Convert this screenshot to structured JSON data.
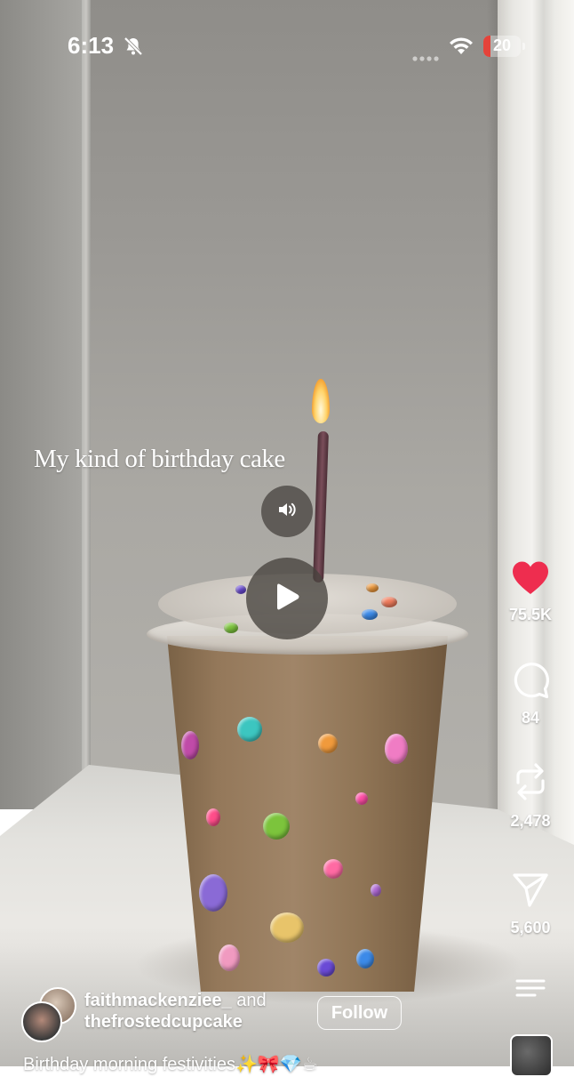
{
  "status_bar": {
    "time": "6:13",
    "battery": "20",
    "battery_level": 0.2,
    "icons": [
      "bell-off-icon",
      "more-dots-icon",
      "wifi-icon",
      "battery-icon"
    ]
  },
  "post": {
    "overlay_text": "My kind of birthday cake",
    "authors": {
      "primary": "faithmackenziee_",
      "joiner": "and",
      "secondary": "thefrostedcupcake"
    },
    "follow_label": "Follow",
    "caption": "Birthday morning festivities✨🎀💎☕"
  },
  "actions": {
    "likes": "75.5K",
    "comments": "84",
    "reposts": "2,478",
    "shares": "5,600",
    "liked": true,
    "like_color": "#ee2d4f"
  },
  "controls": {
    "sound_icon": "speaker-icon",
    "play_icon": "play-icon"
  }
}
